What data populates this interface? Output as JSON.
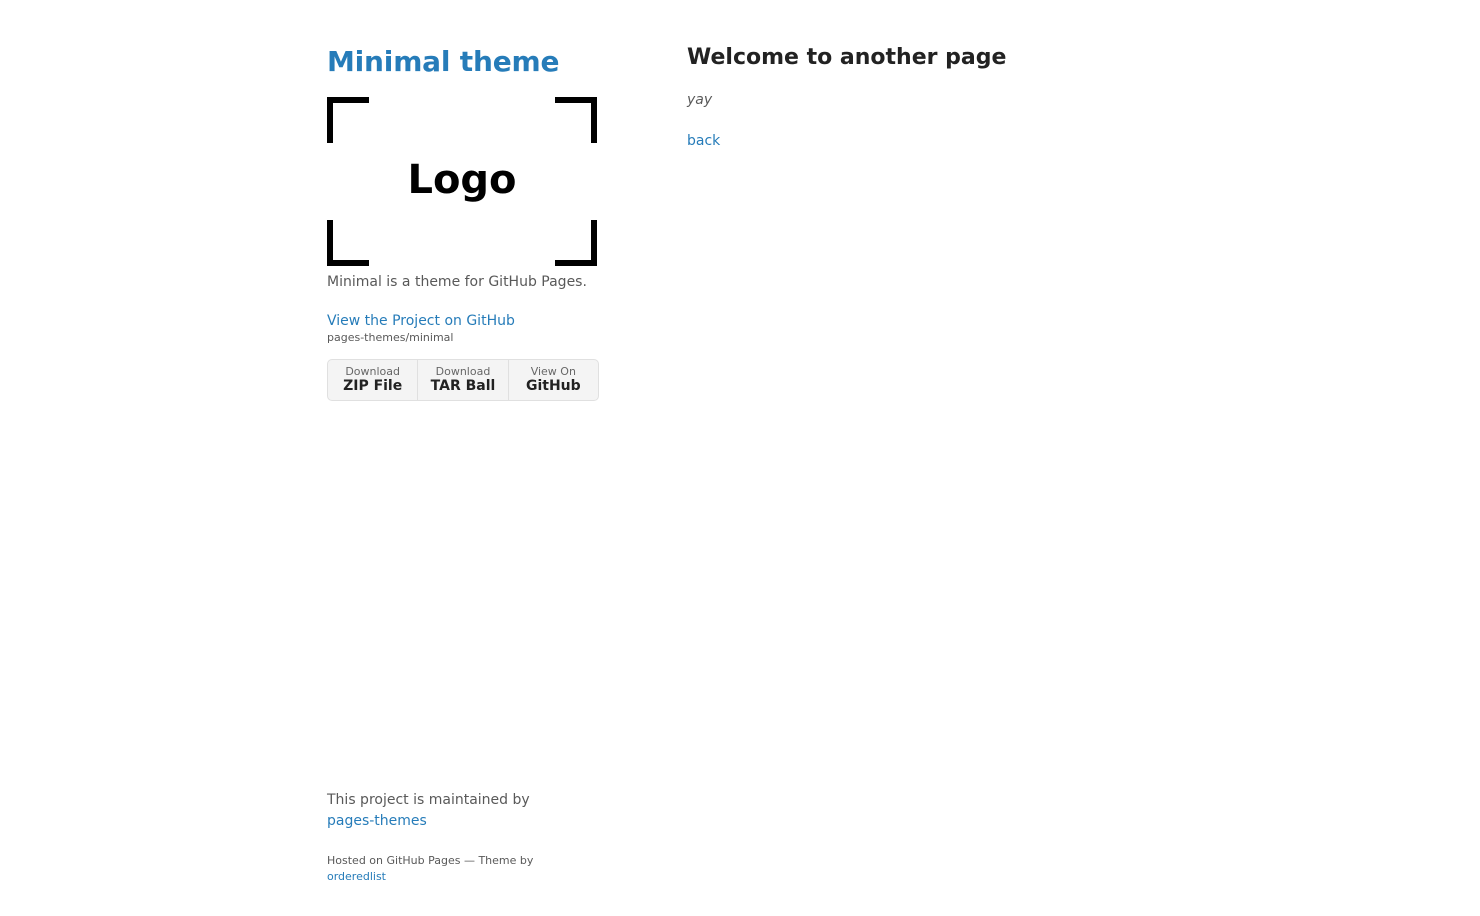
{
  "sidebar": {
    "title": "Minimal theme",
    "logo_text": "Logo",
    "description": "Minimal is a theme for GitHub Pages.",
    "project_link_label": "View the Project on GitHub",
    "repo_name": "pages-themes/minimal",
    "downloads": [
      {
        "small": "Download",
        "big": "ZIP File"
      },
      {
        "small": "Download",
        "big": "TAR Ball"
      },
      {
        "small": "View On",
        "big": "GitHub"
      }
    ]
  },
  "footer": {
    "maintained_prefix": "This project is maintained by",
    "maintained_link": "pages-themes",
    "hosted_prefix": "Hosted on GitHub Pages — Theme by",
    "hosted_link": "orderedlist"
  },
  "main": {
    "heading": "Welcome to another page",
    "emphasis": "yay",
    "back_label": "back"
  },
  "colors": {
    "link": "#267CB9",
    "text": "#595959",
    "heading": "#222222"
  }
}
